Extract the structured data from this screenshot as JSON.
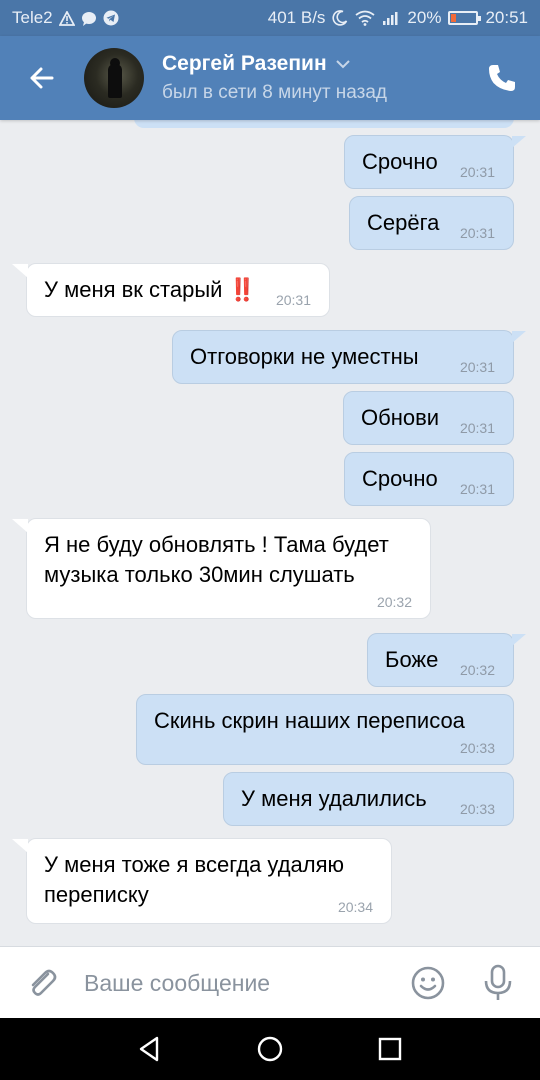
{
  "status_bar": {
    "carrier": "Tele2",
    "speed": "401 B/s",
    "battery": "20%",
    "battery_level": 0.2,
    "time": "20:51"
  },
  "header": {
    "contact_name": "Сергей Разепин",
    "contact_status": "был в сети 8 минут назад"
  },
  "messages": [
    {
      "dir": "out",
      "text": "Срочно",
      "time": "20:31"
    },
    {
      "dir": "out",
      "text": "Серёга",
      "time": "20:31"
    },
    {
      "dir": "in",
      "text": "У меня вк старый ‼️",
      "time": "20:31"
    },
    {
      "dir": "out",
      "text": "Отговорки не уместны",
      "time": "20:31"
    },
    {
      "dir": "out",
      "text": "Обнови",
      "time": "20:31"
    },
    {
      "dir": "out",
      "text": "Срочно",
      "time": "20:31"
    },
    {
      "dir": "in",
      "text": "Я не буду обновлять ! Тама будет\nмузыка только 30мин слушать",
      "time": "20:32"
    },
    {
      "dir": "out",
      "text": "Боже",
      "time": "20:32"
    },
    {
      "dir": "out",
      "text": "Скинь скрин наших переписоа",
      "time": "20:33"
    },
    {
      "dir": "out",
      "text": "У меня удалились",
      "time": "20:33"
    },
    {
      "dir": "in",
      "text": "У меня тоже я всегда удаляю\nпереписку",
      "time": "20:34"
    }
  ],
  "composer": {
    "placeholder": "Ваше сообщение"
  },
  "colors": {
    "header_bg": "#5181b8",
    "status_bg": "#4a76a8",
    "outgoing_bubble": "#cce0f5",
    "incoming_bubble": "#ffffff",
    "chat_bg": "#ebedf0"
  },
  "icons": [
    "back-arrow-icon",
    "chevron-down-icon",
    "phone-icon",
    "paperclip-icon",
    "smile-icon",
    "microphone-icon",
    "nav-back-icon",
    "nav-home-icon",
    "nav-recents-icon"
  ]
}
